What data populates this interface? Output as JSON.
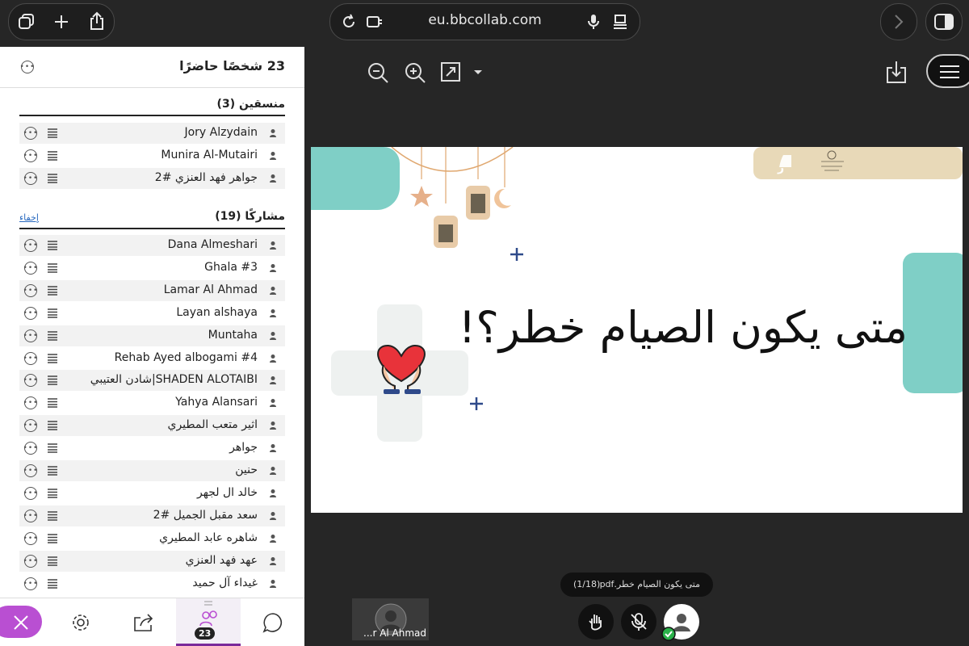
{
  "browser": {
    "url": "eu.bbcollab.com"
  },
  "sidebar": {
    "title": "23 شخصًا حاضرًا",
    "moderators": {
      "heading": "منسقين (3)",
      "items": [
        "Jory Alzydain",
        "Munira Al-Mutairi",
        "جواهر فهد العنزي #2"
      ]
    },
    "participants": {
      "heading": "مشاركًا (19)",
      "hide_label": "إخفاء",
      "items": [
        "Dana Almeshari",
        "Ghala #3",
        "Lamar Al Ahmad",
        "Layan alshaya",
        "Muntaha",
        "Rehab Ayed albogami #4",
        "شادن العتيبي|SHADEN ALOTAIBI",
        "Yahya Alansari",
        "اثير متعب المطيري",
        "جواهر",
        "حنين",
        "خالد ال لجهر",
        "سعد مقبل الجميل #2",
        "شاهره عابد المطيري",
        "عهد فهد العنزي",
        "غيداء آل حميد"
      ]
    }
  },
  "bottom_nav": {
    "attendees_count": "23"
  },
  "slide": {
    "title": "متى يكون الصيام خطر؟!",
    "file_name": "متى يكون الصيام خطر.pdf",
    "page": "(1/18)"
  },
  "video": {
    "label": "...r Al Ahmad"
  },
  "colors": {
    "teal": "#7fcfc6",
    "beige": "#e8d9b8",
    "accent_purple": "#b94fd2",
    "status_green": "#2ab24a"
  }
}
